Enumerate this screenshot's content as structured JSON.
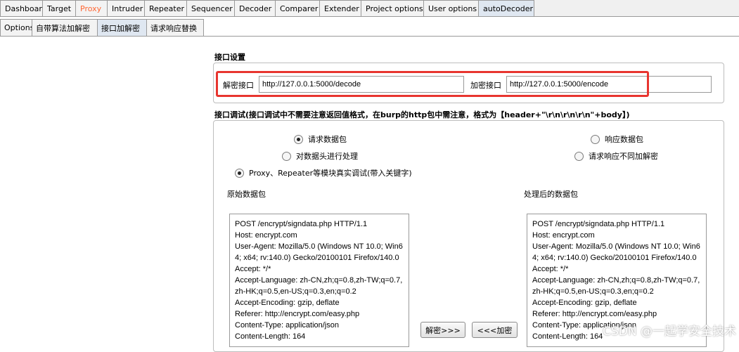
{
  "tabs": [
    "Dashboard",
    "Target",
    "Proxy",
    "Intruder",
    "Repeater",
    "Sequencer",
    "Decoder",
    "Comparer",
    "Extender",
    "Project options",
    "User options",
    "autoDecoder"
  ],
  "subtabs": [
    "Options",
    "自带算法加解密",
    "接口加解密",
    "请求响应替换"
  ],
  "interface_settings": {
    "title": "接口设置",
    "decode_label": "解密接口",
    "decode_value": "http://127.0.0.1:5000/decode",
    "encode_label": "加密接口",
    "encode_value": "http://127.0.0.1:5000/encode"
  },
  "debug": {
    "title": "接口调试(接口调试中不需要注意返回值格式，在burp的http包中需注意，格式为【header+\"\\r\\n\\r\\n\\r\\n\"+body】)",
    "radio_request": "请求数据包",
    "radio_response": "响应数据包",
    "radio_header": "对数据头进行处理",
    "radio_no_decrypt": "请求响应不同加解密",
    "radio_proxy": "Proxy、Repeater等模块真实调试(带入关键字)",
    "original_label": "原始数据包",
    "processed_label": "处理后的数据包",
    "decrypt_button": "解密>>>",
    "encrypt_button": "<<<加密",
    "original_lines": [
      "POST /encrypt/signdata.php HTTP/1.1",
      "Host: encrypt.com",
      "User-Agent: Mozilla/5.0 (Windows NT 10.0; Win64; x64; rv:140.0) Gecko/20100101 Firefox/140.0",
      "Accept: */*",
      "Accept-Language: zh-CN,zh;q=0.8,zh-TW;q=0.7,zh-HK;q=0.5,en-US;q=0.3,en;q=0.2",
      "Accept-Encoding: gzip, deflate",
      "Referer: http://encrypt.com/easy.php",
      "Content-Type: application/json",
      "Content-Length: 164"
    ],
    "processed_lines": [
      "POST /encrypt/signdata.php HTTP/1.1",
      "Host: encrypt.com",
      "User-Agent: Mozilla/5.0 (Windows NT 10.0; Win64; x64; rv:140.0) Gecko/20100101 Firefox/140.0",
      "Accept: */*",
      "Accept-Language: zh-CN,zh;q=0.8,zh-TW;q=0.7,zh-HK;q=0.5,en-US;q=0.3,en;q=0.2",
      "Accept-Encoding: gzip, deflate",
      "Referer: http://encrypt.com/easy.php",
      "Content-Type: application/json",
      "Content-Length: 164"
    ]
  },
  "watermark": "CSDN @一起学安全技术",
  "colors": {
    "highlight": "#e8352f",
    "proxy_tab": "#ff6633"
  }
}
